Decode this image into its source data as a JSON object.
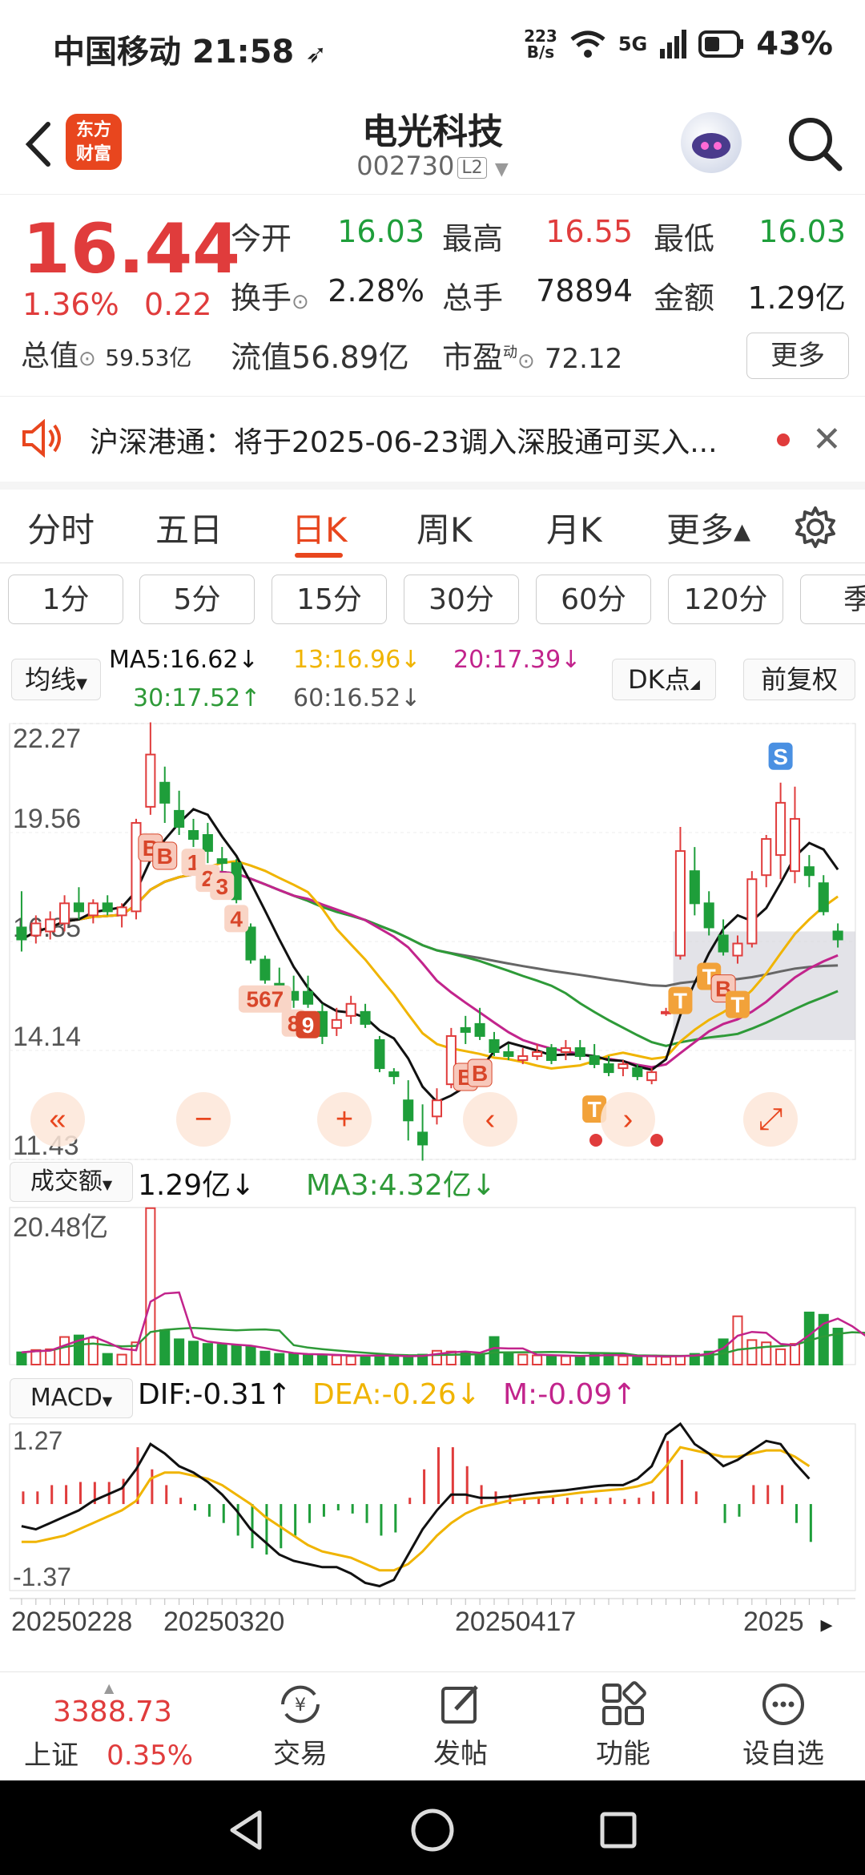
{
  "status_bar": {
    "carrier": "中国移动",
    "time": "21:58",
    "net_speed_value": "223",
    "net_speed_unit": "B/s",
    "network": "5G",
    "battery": "43%"
  },
  "header": {
    "app_logo_line1": "东方",
    "app_logo_line2": "财富",
    "stock_name": "电光科技",
    "stock_code": "002730",
    "level_badge": "L2"
  },
  "quote": {
    "price": "16.44",
    "change_pct": "1.36%",
    "change_amt": "0.22",
    "rows": [
      [
        {
          "label": "今开",
          "value": "16.03",
          "color": "#1e9e3a"
        },
        {
          "label": "最高",
          "value": "16.55",
          "color": "#e03c3c"
        },
        {
          "label": "最低",
          "value": "16.03",
          "color": "#1e9e3a"
        }
      ],
      [
        {
          "label": "换手",
          "value": "2.28%",
          "color": "#222222"
        },
        {
          "label": "总手",
          "value": "78894",
          "color": "#222222"
        },
        {
          "label": "金额",
          "value": "1.29亿",
          "color": "#222222"
        }
      ]
    ],
    "total_value_label": "总值",
    "total_value": "59.53亿",
    "float_value_label": "流值",
    "float_value": "56.89亿",
    "pe_label": "市盈",
    "pe_superscript": "动",
    "pe_value": "72.12",
    "more_button": "更多"
  },
  "notice": {
    "text": "沪深港通：将于2025-06-23调入深股通可买入..."
  },
  "period_tabs": [
    "分时",
    "五日",
    "日K",
    "周K",
    "月K",
    "更多▴"
  ],
  "active_period": "日K",
  "interval_buttons": [
    "1分",
    "5分",
    "15分",
    "30分",
    "60分",
    "120分",
    "季"
  ],
  "ma_legend": {
    "selector": "均线",
    "ma5": "MA5:16.62↓",
    "ma13": "13:16.96↓",
    "ma20": "20:17.39↓",
    "ma30": "30:17.52↑",
    "ma60": "60:16.52↓",
    "dk_button": "DK点",
    "adjust_button": "前复权"
  },
  "colors": {
    "up": "#e03c3c",
    "down": "#1e9e3a",
    "ma5": "#111111",
    "ma13": "#f0b400",
    "ma20": "#c2248c",
    "ma30": "#2e9a38",
    "ma60": "#666666",
    "accent": "#e8461e"
  },
  "chart_data": {
    "type": "candlestick",
    "price_axis_labels": [
      "22.27",
      "19.56",
      "16.85",
      "14.14",
      "11.43"
    ],
    "ylim": [
      11.43,
      22.27
    ],
    "date_labels": [
      "20250228",
      "20250320",
      "20250417",
      "2025"
    ],
    "candles": [
      {
        "o": 17.2,
        "h": 18.1,
        "l": 16.6,
        "c": 16.9
      },
      {
        "o": 17.0,
        "h": 17.5,
        "l": 16.8,
        "c": 17.3
      },
      {
        "o": 17.1,
        "h": 17.6,
        "l": 16.9,
        "c": 17.4
      },
      {
        "o": 17.3,
        "h": 18.0,
        "l": 17.1,
        "c": 17.8
      },
      {
        "o": 17.8,
        "h": 18.2,
        "l": 17.4,
        "c": 17.6
      },
      {
        "o": 17.5,
        "h": 17.9,
        "l": 17.3,
        "c": 17.8
      },
      {
        "o": 17.8,
        "h": 18.0,
        "l": 17.5,
        "c": 17.6
      },
      {
        "o": 17.5,
        "h": 17.8,
        "l": 17.2,
        "c": 17.7
      },
      {
        "o": 17.6,
        "h": 19.9,
        "l": 17.4,
        "c": 19.8
      },
      {
        "o": 20.2,
        "h": 22.3,
        "l": 20.0,
        "c": 21.5
      },
      {
        "o": 20.8,
        "h": 21.2,
        "l": 19.8,
        "c": 20.3
      },
      {
        "o": 20.1,
        "h": 20.6,
        "l": 19.5,
        "c": 19.7
      },
      {
        "o": 19.6,
        "h": 19.9,
        "l": 19.2,
        "c": 19.4
      },
      {
        "o": 19.5,
        "h": 19.8,
        "l": 18.8,
        "c": 19.1
      },
      {
        "o": 18.9,
        "h": 19.2,
        "l": 18.6,
        "c": 18.8
      },
      {
        "o": 18.8,
        "h": 18.9,
        "l": 17.8,
        "c": 17.9
      },
      {
        "o": 17.2,
        "h": 17.3,
        "l": 16.3,
        "c": 16.4
      },
      {
        "o": 16.4,
        "h": 16.5,
        "l": 15.8,
        "c": 15.9
      },
      {
        "o": 15.8,
        "h": 16.2,
        "l": 15.3,
        "c": 15.5
      },
      {
        "o": 15.6,
        "h": 16.0,
        "l": 15.2,
        "c": 15.4
      },
      {
        "o": 15.6,
        "h": 16.0,
        "l": 15.2,
        "c": 15.3
      },
      {
        "o": 15.1,
        "h": 15.3,
        "l": 14.3,
        "c": 14.5
      },
      {
        "o": 14.7,
        "h": 15.2,
        "l": 14.5,
        "c": 14.9
      },
      {
        "o": 15.0,
        "h": 15.5,
        "l": 14.8,
        "c": 15.3
      },
      {
        "o": 15.1,
        "h": 15.3,
        "l": 14.7,
        "c": 14.8
      },
      {
        "o": 14.4,
        "h": 14.5,
        "l": 13.6,
        "c": 13.7
      },
      {
        "o": 13.6,
        "h": 13.7,
        "l": 13.3,
        "c": 13.5
      },
      {
        "o": 12.9,
        "h": 13.4,
        "l": 11.9,
        "c": 12.4
      },
      {
        "o": 12.1,
        "h": 12.8,
        "l": 11.4,
        "c": 11.8
      },
      {
        "o": 12.5,
        "h": 13.2,
        "l": 12.3,
        "c": 12.9
      },
      {
        "o": 13.3,
        "h": 14.7,
        "l": 13.2,
        "c": 14.5
      },
      {
        "o": 14.7,
        "h": 15.0,
        "l": 14.3,
        "c": 14.6
      },
      {
        "o": 14.8,
        "h": 15.2,
        "l": 14.4,
        "c": 14.5
      },
      {
        "o": 14.4,
        "h": 14.6,
        "l": 14.0,
        "c": 14.1
      },
      {
        "o": 14.1,
        "h": 14.3,
        "l": 13.9,
        "c": 14.0
      },
      {
        "o": 13.9,
        "h": 14.2,
        "l": 13.8,
        "c": 14.0
      },
      {
        "o": 14.0,
        "h": 14.3,
        "l": 13.9,
        "c": 14.1
      },
      {
        "o": 14.2,
        "h": 14.3,
        "l": 13.8,
        "c": 13.9
      },
      {
        "o": 14.1,
        "h": 14.4,
        "l": 13.9,
        "c": 14.2
      },
      {
        "o": 14.2,
        "h": 14.4,
        "l": 13.9,
        "c": 14.0
      },
      {
        "o": 14.0,
        "h": 14.3,
        "l": 13.7,
        "c": 13.8
      },
      {
        "o": 13.8,
        "h": 14.0,
        "l": 13.5,
        "c": 13.6
      },
      {
        "o": 13.7,
        "h": 13.9,
        "l": 13.5,
        "c": 13.8
      },
      {
        "o": 13.7,
        "h": 13.8,
        "l": 13.4,
        "c": 13.5
      },
      {
        "o": 13.4,
        "h": 13.7,
        "l": 13.3,
        "c": 13.6
      },
      {
        "o": 15.1,
        "h": 15.2,
        "l": 15.0,
        "c": 15.1
      },
      {
        "o": 16.5,
        "h": 19.7,
        "l": 16.4,
        "c": 19.1
      },
      {
        "o": 18.6,
        "h": 19.2,
        "l": 17.5,
        "c": 17.8
      },
      {
        "o": 17.8,
        "h": 18.1,
        "l": 17.0,
        "c": 17.2
      },
      {
        "o": 17.0,
        "h": 17.4,
        "l": 16.5,
        "c": 16.6
      },
      {
        "o": 16.5,
        "h": 17.0,
        "l": 16.3,
        "c": 16.8
      },
      {
        "o": 16.8,
        "h": 18.6,
        "l": 16.7,
        "c": 18.4
      },
      {
        "o": 18.5,
        "h": 19.5,
        "l": 18.2,
        "c": 19.4
      },
      {
        "o": 19.0,
        "h": 20.8,
        "l": 18.4,
        "c": 20.3
      },
      {
        "o": 18.6,
        "h": 20.7,
        "l": 18.3,
        "c": 19.9
      },
      {
        "o": 18.7,
        "h": 19.0,
        "l": 18.2,
        "c": 18.5
      },
      {
        "o": 18.3,
        "h": 18.5,
        "l": 17.5,
        "c": 17.6
      },
      {
        "o": 17.1,
        "h": 17.3,
        "l": 16.7,
        "c": 16.9
      }
    ],
    "markers": [
      {
        "text": "B",
        "i": 9,
        "style": "boxed"
      },
      {
        "text": "B",
        "i": 10,
        "style": "boxed"
      },
      {
        "text": "1",
        "i": 12,
        "style": "plain"
      },
      {
        "text": "2",
        "i": 13,
        "style": "plain"
      },
      {
        "text": "3",
        "i": 14,
        "style": "plain"
      },
      {
        "text": "4",
        "i": 15,
        "style": "plain"
      },
      {
        "text": "567",
        "i": 17,
        "style": "plain"
      },
      {
        "text": "8",
        "i": 19,
        "style": "plain"
      },
      {
        "text": "9",
        "i": 20,
        "style": "dark"
      },
      {
        "text": "B",
        "i": 31,
        "style": "boxed"
      },
      {
        "text": "B",
        "i": 32,
        "style": "boxed"
      },
      {
        "text": "T",
        "i": 40,
        "style": "orange"
      },
      {
        "text": "T",
        "i": 46,
        "style": "orange"
      },
      {
        "text": "T",
        "i": 48,
        "style": "orange"
      },
      {
        "text": "B",
        "i": 49,
        "style": "boxed"
      },
      {
        "text": "T",
        "i": 50,
        "style": "orange"
      },
      {
        "text": "S",
        "i": 53,
        "style": "blue"
      }
    ],
    "volume": {
      "selector": "成交额",
      "value": "1.29亿↓",
      "ma3": "MA3:4.32亿↓",
      "axis_label": "20.48亿",
      "ylim": [
        0,
        20.48
      ],
      "values": [
        1.6,
        1.9,
        2.0,
        3.6,
        3.8,
        3.5,
        1.4,
        1.3,
        2.9,
        20.4,
        4.5,
        3.3,
        3.0,
        2.7,
        2.6,
        2.5,
        2.3,
        1.7,
        1.4,
        1.4,
        1.3,
        1.3,
        1.2,
        1.1,
        1.2,
        1.2,
        1.1,
        1.0,
        1.3,
        1.8,
        1.7,
        1.6,
        1.3,
        3.6,
        1.4,
        1.3,
        1.2,
        1.2,
        1.1,
        1.1,
        1.3,
        1.3,
        1.1,
        1.0,
        1.2,
        1.0,
        1.1,
        1.4,
        1.7,
        3.3,
        6.3,
        3.2,
        2.9,
        2.0,
        2.7,
        6.8,
        6.5,
        4.7,
        3.8,
        2.5
      ]
    },
    "macd": {
      "selector": "MACD",
      "dif": "DIF:-0.31↑",
      "dea": "DEA:-0.26↓",
      "m": "M:-0.09↑",
      "axis_top": "1.27",
      "axis_bottom": "-1.37",
      "ylim": [
        -1.37,
        1.27
      ],
      "dif_values": [
        -0.35,
        -0.4,
        -0.3,
        -0.2,
        -0.1,
        0.05,
        0.15,
        0.25,
        0.55,
        0.95,
        0.8,
        0.6,
        0.5,
        0.35,
        0.15,
        -0.1,
        -0.4,
        -0.6,
        -0.8,
        -0.9,
        -0.95,
        -1.0,
        -1.0,
        -1.1,
        -1.25,
        -1.3,
        -1.2,
        -0.8,
        -0.4,
        -0.1,
        0.15,
        0.15,
        0.1,
        0.1,
        0.12,
        0.15,
        0.18,
        0.2,
        0.22,
        0.25,
        0.28,
        0.3,
        0.3,
        0.4,
        0.6,
        1.1,
        1.27,
        0.95,
        0.8,
        0.6,
        0.7,
        0.85,
        1.0,
        0.95,
        0.65,
        0.4
      ],
      "dea_values": [
        -0.6,
        -0.6,
        -0.55,
        -0.5,
        -0.4,
        -0.3,
        -0.2,
        -0.1,
        0.05,
        0.4,
        0.5,
        0.5,
        0.45,
        0.4,
        0.3,
        0.15,
        0.0,
        -0.2,
        -0.35,
        -0.5,
        -0.65,
        -0.75,
        -0.8,
        -0.85,
        -0.95,
        -1.05,
        -1.05,
        -0.95,
        -0.75,
        -0.5,
        -0.3,
        -0.15,
        -0.05,
        0.0,
        0.05,
        0.08,
        0.1,
        0.12,
        0.15,
        0.18,
        0.2,
        0.22,
        0.24,
        0.28,
        0.35,
        0.6,
        0.9,
        0.85,
        0.8,
        0.75,
        0.75,
        0.8,
        0.85,
        0.85,
        0.75,
        0.6
      ],
      "hist_values": [
        0.2,
        0.2,
        0.3,
        0.3,
        0.35,
        0.35,
        0.35,
        0.4,
        0.9,
        0.55,
        0.3,
        0.1,
        -0.1,
        -0.2,
        -0.3,
        -0.5,
        -0.7,
        -0.8,
        -0.7,
        -0.5,
        -0.3,
        -0.2,
        -0.1,
        -0.15,
        -0.3,
        -0.5,
        -0.45,
        0.1,
        0.55,
        0.9,
        0.9,
        0.6,
        0.3,
        0.2,
        0.15,
        0.1,
        0.1,
        0.1,
        0.1,
        0.1,
        0.1,
        0.1,
        0.08,
        0.1,
        0.2,
        1.0,
        0.7,
        0.2,
        0.0,
        -0.3,
        -0.2,
        0.3,
        0.3,
        0.3,
        -0.3,
        -0.6
      ]
    }
  },
  "chart_controls": {
    "scroll_left": "«",
    "zoom_out": "−",
    "zoom_in": "+",
    "prev": "‹",
    "next": "›",
    "fullscreen": "⤢",
    "next_page": "▸"
  },
  "bottom_nav": {
    "index_value": "3388.73",
    "index_name": "上证",
    "index_change": "0.35%",
    "items": [
      "交易",
      "发帖",
      "功能",
      "设自选"
    ]
  }
}
